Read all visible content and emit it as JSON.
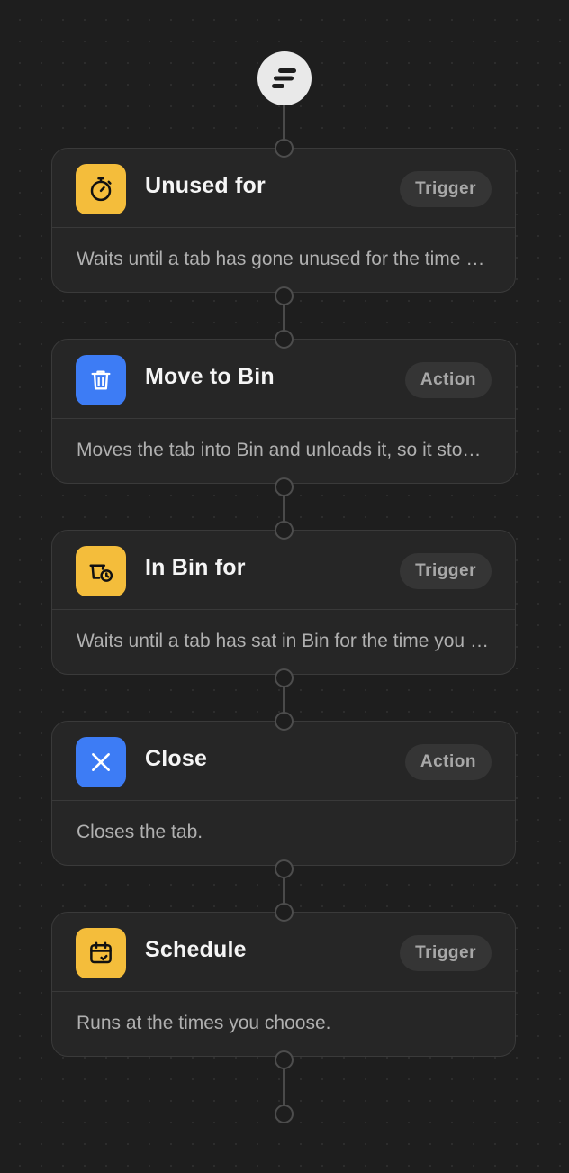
{
  "flow": {
    "start_icon": "flow-lines-icon",
    "steps": [
      {
        "title": "Unused for",
        "badge": "Trigger",
        "description": "Waits until a tab has gone unused for the time you set.",
        "icon": "stopwatch-icon",
        "color": "#f4bd3b"
      },
      {
        "title": "Move to Bin",
        "badge": "Action",
        "description": "Moves the tab into Bin and unloads it, so it stops using memory.",
        "icon": "trash-icon",
        "color": "#3d7cf5"
      },
      {
        "title": "In Bin for",
        "badge": "Trigger",
        "description": "Waits until a tab has sat in Bin for the time you set.",
        "icon": "bin-clock-icon",
        "color": "#f4bd3b"
      },
      {
        "title": "Close",
        "badge": "Action",
        "description": "Closes the tab.",
        "icon": "close-icon",
        "color": "#3d7cf5"
      },
      {
        "title": "Schedule",
        "badge": "Trigger",
        "description": "Runs at the times you choose.",
        "icon": "calendar-check-icon",
        "color": "#f4bd3b"
      }
    ]
  }
}
